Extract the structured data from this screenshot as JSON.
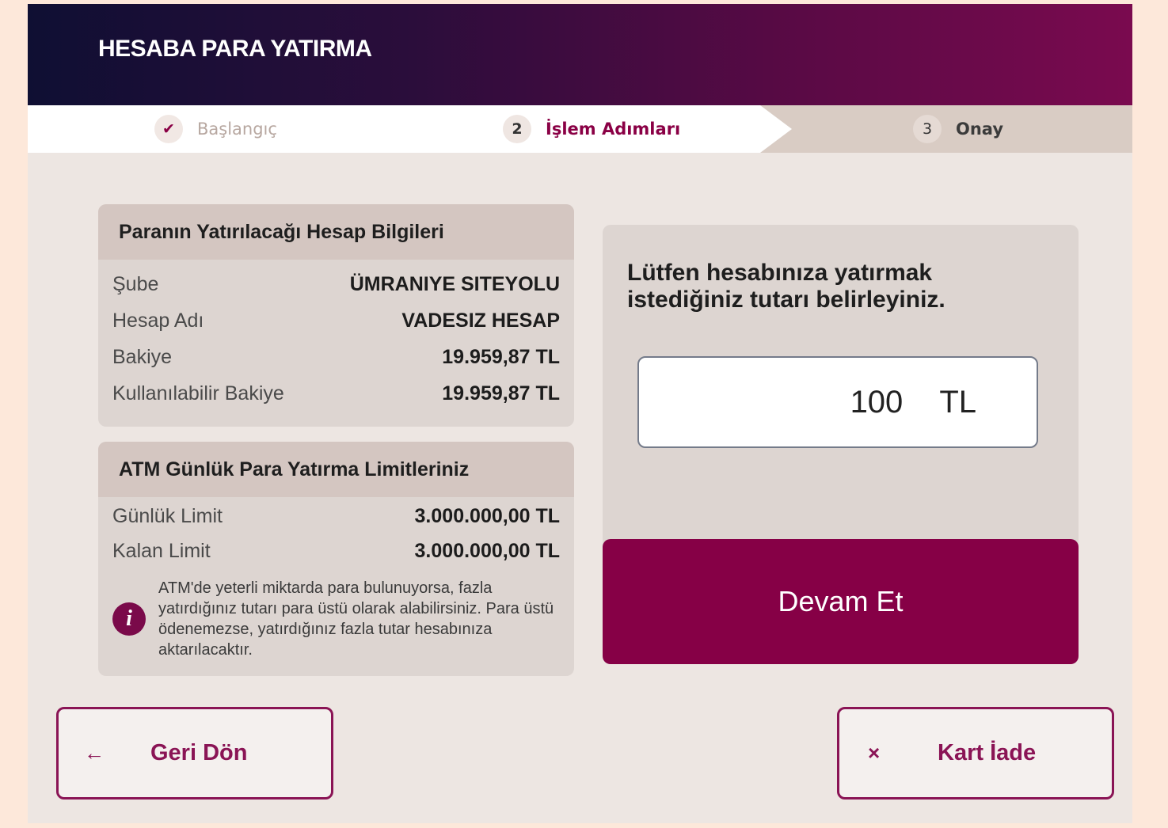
{
  "header": {
    "title": "HESABA PARA YATIRMA"
  },
  "stepper": {
    "steps": [
      {
        "marker": "✔",
        "label": "Başlangıç",
        "state": "done"
      },
      {
        "marker": "2",
        "label": "İşlem Adımları",
        "state": "active"
      },
      {
        "marker": "3",
        "label": "Onay",
        "state": "upcoming"
      }
    ]
  },
  "account_card": {
    "title": "Paranın Yatırılacağı Hesap Bilgileri",
    "rows": [
      {
        "label": "Şube",
        "value": "ÜMRANIYE SITEYOLU"
      },
      {
        "label": "Hesap Adı",
        "value": "VADESIZ HESAP"
      },
      {
        "label": "Bakiye",
        "value": "19.959,87 TL"
      },
      {
        "label": "Kullanılabilir Bakiye",
        "value": "19.959,87 TL"
      }
    ]
  },
  "limits_card": {
    "title": "ATM Günlük Para Yatırma Limitleriniz",
    "rows": [
      {
        "label": "Günlük Limit",
        "value": "3.000.000,00 TL"
      },
      {
        "label": "Kalan Limit",
        "value": "3.000.000,00 TL"
      }
    ],
    "note_icon": "info-icon",
    "note": "ATM'de yeterli miktarda para bulunuyorsa, fazla yatırdığınız tutarı para üstü olarak alabilirsiniz. Para üstü ödenemezse, yatırdığınız fazla tutar hesabınıza aktarılacaktır."
  },
  "amount_panel": {
    "prompt": "Lütfen hesabınıza yatırmak istediğiniz tutarı belirleyiniz.",
    "amount": "100",
    "currency": "TL"
  },
  "actions": {
    "continue_label": "Devam Et",
    "back_icon": "←",
    "back_label": "Geri Dön",
    "card_return_icon": "×",
    "card_return_label": "Kart İade"
  },
  "colors": {
    "accent": "#860046",
    "page_background": "#fde8da",
    "panel_background": "#ddd5d1"
  }
}
